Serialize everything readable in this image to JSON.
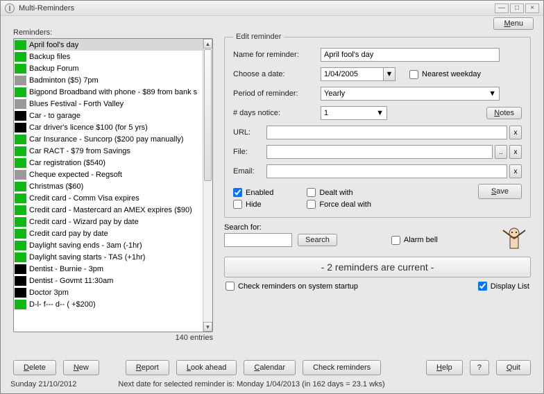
{
  "window": {
    "title": "Multi-Reminders"
  },
  "menu_button": "Menu",
  "reminders_label": "Reminders:",
  "entries_count": "140 entries",
  "list": [
    {
      "c": "#11b815",
      "t": "April fool's day",
      "sel": true
    },
    {
      "c": "#11b815",
      "t": "Backup files"
    },
    {
      "c": "#11b815",
      "t": "Backup Forum"
    },
    {
      "c": "#9a9a9a",
      "t": "Badminton ($5) 7pm"
    },
    {
      "c": "#11b815",
      "t": "Bigpond Broadband with phone - $89 from bank s"
    },
    {
      "c": "#9a9a9a",
      "t": "Blues Festival - Forth Valley"
    },
    {
      "c": "#000000",
      "t": "Car - to garage"
    },
    {
      "c": "#000000",
      "t": "Car driver's licence $100 (for 5 yrs)"
    },
    {
      "c": "#11b815",
      "t": "Car Insurance - Suncorp ($200 pay manually)"
    },
    {
      "c": "#11b815",
      "t": "Car RACT - $79 from Savings"
    },
    {
      "c": "#11b815",
      "t": "Car registration ($540)"
    },
    {
      "c": "#9a9a9a",
      "t": "Cheque expected - Regsoft"
    },
    {
      "c": "#11b815",
      "t": "Christmas ($60)"
    },
    {
      "c": "#11b815",
      "t": "Credit card - Comm Visa expires"
    },
    {
      "c": "#11b815",
      "t": "Credit card - Mastercard an AMEX expires ($90)"
    },
    {
      "c": "#11b815",
      "t": "Credit card - Wizard pay by date"
    },
    {
      "c": "#11b815",
      "t": "Credit card pay by date"
    },
    {
      "c": "#11b815",
      "t": "Daylight saving ends - 3am (-1hr)"
    },
    {
      "c": "#11b815",
      "t": "Daylight saving starts - TAS (+1hr)"
    },
    {
      "c": "#000000",
      "t": "Dentist - Burnie - 3pm"
    },
    {
      "c": "#000000",
      "t": "Dentist - Govmt 11:30am"
    },
    {
      "c": "#000000",
      "t": "Doctor 3pm"
    },
    {
      "c": "#11b815",
      "t": "D-l-   f---  d--  (  +$200)"
    }
  ],
  "edit": {
    "legend": "Edit reminder",
    "name_label": "Name for reminder:",
    "name_value": "April fool's day",
    "date_label": "Choose a date:",
    "date_value": "1/04/2005",
    "nearest_label": "Nearest weekday",
    "period_label": "Period of reminder:",
    "period_value": "Yearly",
    "notice_label": "# days notice:",
    "notice_value": "1",
    "notes_btn": "Notes",
    "url_label": "URL:",
    "file_label": "File:",
    "email_label": "Email:",
    "enabled": "Enabled",
    "hide": "Hide",
    "dealt": "Dealt with",
    "force": "Force deal with",
    "save_btn": "Save"
  },
  "search": {
    "label": "Search for:",
    "btn": "Search",
    "alarm": "Alarm bell"
  },
  "banner": "- 2 reminders are current -",
  "startup_chk": "Check reminders on system startup",
  "display_list": "Display List",
  "buttons": {
    "delete": "Delete",
    "new": "New",
    "report": "Report",
    "look": "Look ahead",
    "calendar": "Calendar",
    "check": "Check reminders",
    "help": "Help",
    "q": "?",
    "quit": "Quit"
  },
  "status": {
    "date": "Sunday  21/10/2012",
    "next": "Next date for selected reminder is: Monday 1/04/2013 (in 162 days = 23.1 wks)"
  }
}
